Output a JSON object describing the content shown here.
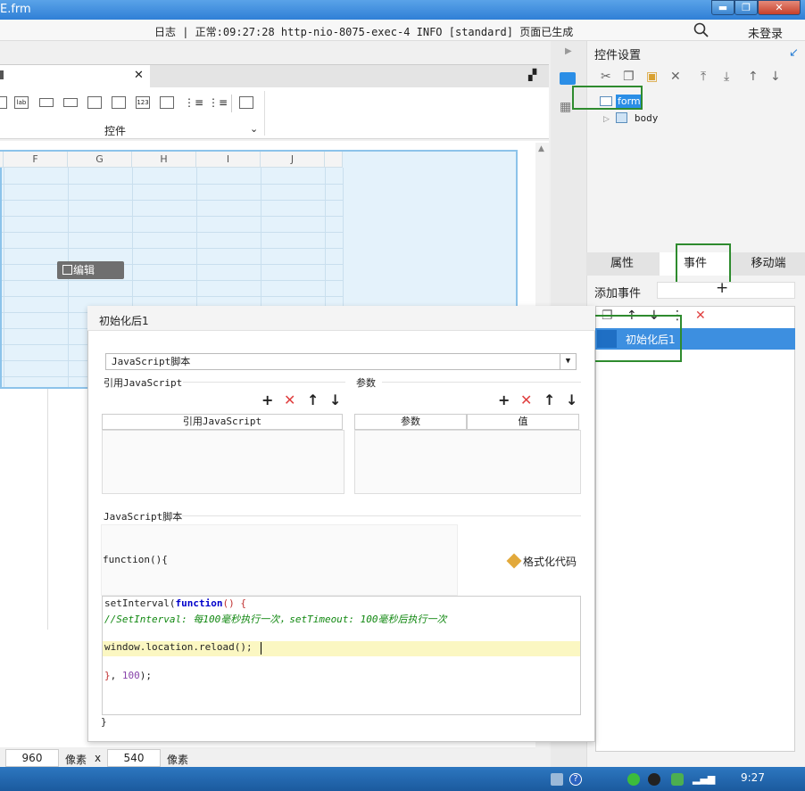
{
  "window": {
    "title": "E.frm",
    "minimize": "▬",
    "maximize": "❐",
    "close": "✕"
  },
  "statusbar": {
    "log": "日志 | 正常:09:27:28 http-nio-8075-exec-4 INFO [standard] 页面已生成",
    "login": "未登录"
  },
  "toolbar": {
    "control_label": "控件",
    "icons": [
      "lab"
    ],
    "dropdown": "⌄"
  },
  "grid": {
    "columns": [
      "F",
      "G",
      "H",
      "I",
      "J"
    ],
    "edit_label": "编辑"
  },
  "sizebar": {
    "width": "960",
    "unit1": "像素",
    "x": "x",
    "height": "540",
    "unit2": "像素"
  },
  "taskbar": {
    "time": "9:27"
  },
  "right_panel": {
    "title": "控件设置",
    "tree": {
      "form": "form",
      "body": "body"
    },
    "tabs": [
      "属性",
      "事件",
      "移动端"
    ],
    "add_event_label": "添加事件",
    "event_item": "初始化后1"
  },
  "dialog": {
    "title": "初始化后1",
    "type_value": "JavaScript脚本",
    "ref_section": "引用JavaScript",
    "param_section": "参数",
    "ref_col": "引用JavaScript",
    "param_col": "参数",
    "value_col": "值",
    "script_section": "JavaScript脚本",
    "func_open": "function(){",
    "format_btn": "格式化代码",
    "func_close": "}",
    "code": {
      "line1_a": "setInterval(",
      "line1_kw": "function",
      "line1_b": "() {",
      "line2": "//SetInterval: 每100毫秒执行一次，setTimeout: 100毫秒后执行一次",
      "line4": "window.location.reload();",
      "line6_a": "}",
      "line6_b": ", ",
      "line6_num": "100",
      "line6_c": ");"
    }
  },
  "colors": {
    "highlight_box": "#2e8b2e",
    "selection": "#3d8fe0",
    "delete": "#e04040"
  }
}
